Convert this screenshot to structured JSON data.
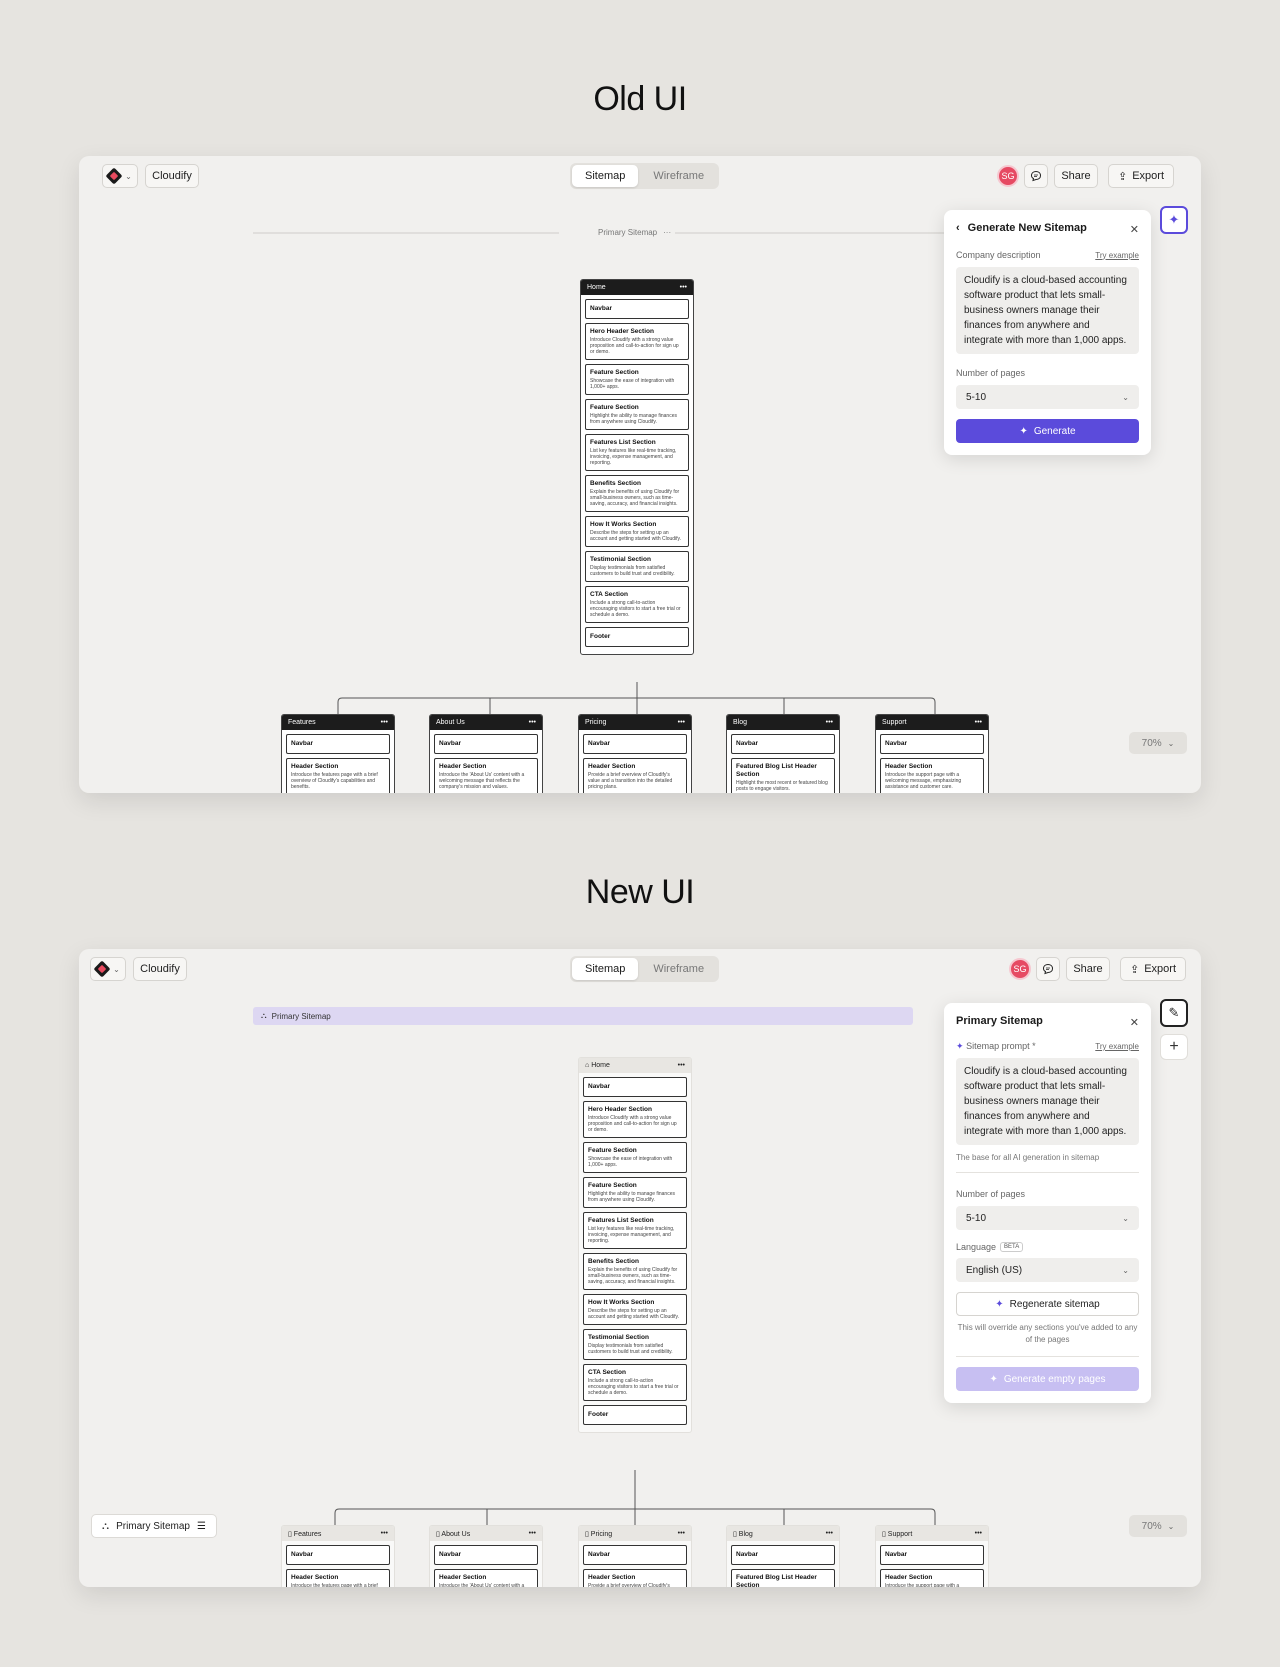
{
  "titles": {
    "old": "Old UI",
    "new": "New UI"
  },
  "toolbar": {
    "project": "Cloudify",
    "tabs": [
      "Sitemap",
      "Wireframe"
    ],
    "avatar": "SG",
    "share": "Share",
    "export": "Export",
    "zoom": "70%"
  },
  "canvas": {
    "sitemap_label": "Primary Sitemap",
    "bottom_pill": "Primary Sitemap"
  },
  "home": {
    "name": "Home",
    "sections": [
      {
        "title": "Navbar",
        "desc": ""
      },
      {
        "title": "Hero Header Section",
        "desc": "Introduce Cloudify with a strong value proposition and call-to-action for sign up or demo."
      },
      {
        "title": "Feature Section",
        "desc": "Showcase the ease of integration with 1,000+ apps."
      },
      {
        "title": "Feature Section",
        "desc": "Highlight the ability to manage finances from anywhere using Cloudify."
      },
      {
        "title": "Features List Section",
        "desc": "List key features like real-time tracking, invoicing, expense management, and reporting."
      },
      {
        "title": "Benefits Section",
        "desc": "Explain the benefits of using Cloudify for small-business owners, such as time-saving, accuracy, and financial insights."
      },
      {
        "title": "How It Works Section",
        "desc": "Describe the steps for setting up an account and getting started with Cloudify."
      },
      {
        "title": "Testimonial Section",
        "desc": "Display testimonials from satisfied customers to build trust and credibility."
      },
      {
        "title": "CTA Section",
        "desc": "Include a strong call-to-action encouraging visitors to start a free trial or schedule a demo."
      },
      {
        "title": "Footer",
        "desc": ""
      }
    ]
  },
  "children": [
    {
      "name": "Features",
      "sec": "Header Section",
      "desc": "Introduce the features page with a brief overview of Cloudify's capabilities and benefits."
    },
    {
      "name": "About Us",
      "sec": "Header Section",
      "desc": "Introduce the 'About Us' content with a welcoming message that reflects the company's mission and values."
    },
    {
      "name": "Pricing",
      "sec": "Header Section",
      "desc": "Provide a brief overview of Cloudify's value and a transition into the detailed pricing plans."
    },
    {
      "name": "Blog",
      "sec": "Featured Blog List Header Section",
      "desc": "Highlight the most recent or featured blog posts to engage visitors."
    },
    {
      "name": "Support",
      "sec": "Header Section",
      "desc": "Introduce the support page with a welcoming message, emphasizing assistance and customer care."
    }
  ],
  "child_navbar": "Navbar",
  "old_panel": {
    "title": "Generate New Sitemap",
    "desc_label": "Company description",
    "try_example": "Try example",
    "description": "Cloudify is a cloud-based accounting software product that lets small-business owners manage their finances from anywhere and integrate with more than 1,000 apps.",
    "pages_label": "Number of pages",
    "pages_value": "5-10",
    "generate": "Generate"
  },
  "new_panel": {
    "title": "Primary Sitemap",
    "prompt_label": "Sitemap prompt *",
    "try_example": "Try example",
    "description": "Cloudify is a cloud-based accounting software product that lets small-business owners manage their finances from anywhere and integrate with more than 1,000 apps.",
    "prompt_hint": "The base for all AI generation in sitemap",
    "pages_label": "Number of pages",
    "pages_value": "5-10",
    "language_label": "Language",
    "beta": "BETA",
    "language_value": "English (US)",
    "regenerate": "Regenerate sitemap",
    "regenerate_hint": "This will override any sections you've added to any of the pages",
    "generate_empty": "Generate empty pages"
  },
  "colors": {
    "accent": "#5b4bdb",
    "avatar": "#e64a63",
    "banner": "#ddd7f2"
  }
}
